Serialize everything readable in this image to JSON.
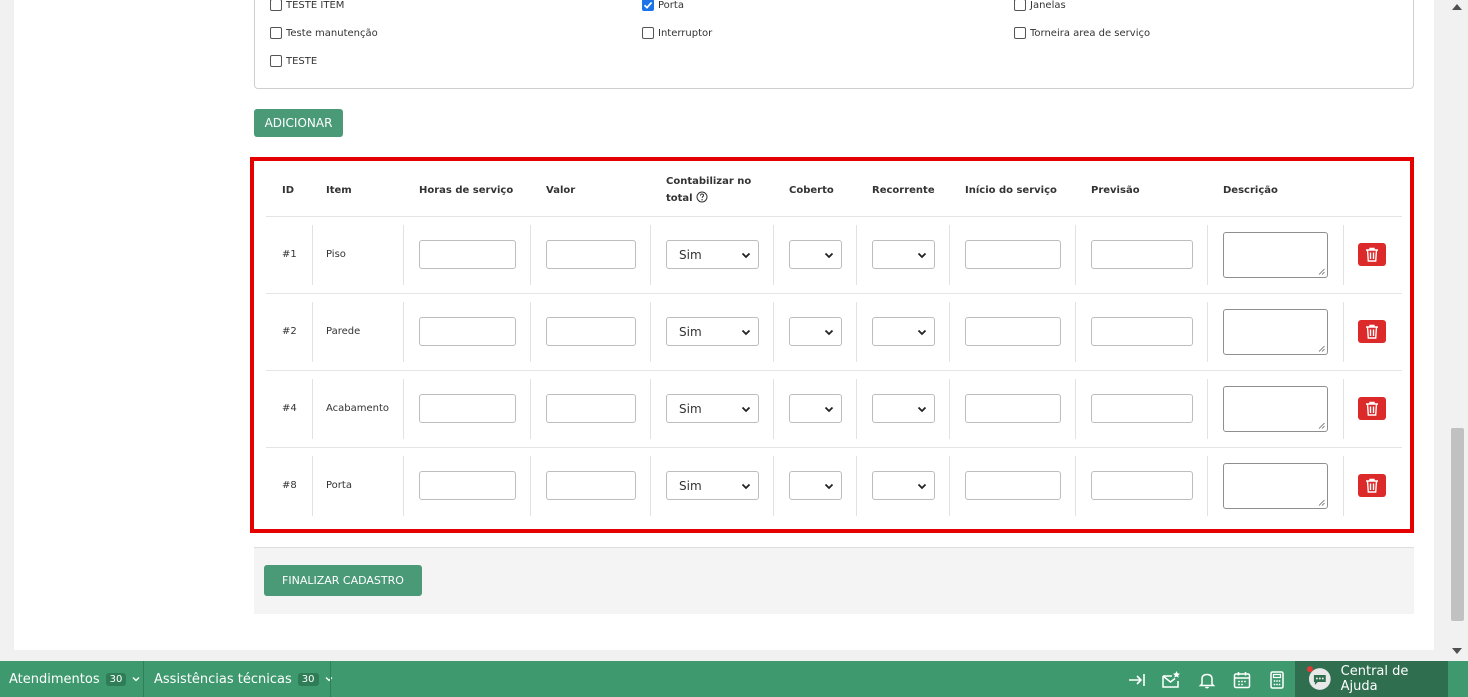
{
  "checkboxes": [
    {
      "label": "TESTE ITEM",
      "checked": false
    },
    {
      "label": "Porta",
      "checked": true
    },
    {
      "label": "Janelas",
      "checked": false
    },
    {
      "label": "Teste manutenção",
      "checked": false
    },
    {
      "label": "Interruptor",
      "checked": false
    },
    {
      "label": "Torneira area de serviço",
      "checked": false
    },
    {
      "label": "TESTE",
      "checked": false
    }
  ],
  "add_button": "ADICIONAR",
  "table": {
    "headers": {
      "id": "ID",
      "item": "Item",
      "hours": "Horas de serviço",
      "value": "Valor",
      "count_line1": "Contabilizar no",
      "count_line2": "total",
      "covered": "Coberto",
      "recurring": "Recorrente",
      "start": "Início do serviço",
      "forecast": "Previsão",
      "description": "Descrição"
    },
    "rows": [
      {
        "id": "#1",
        "item": "Piso",
        "count": "Sim"
      },
      {
        "id": "#2",
        "item": "Parede",
        "count": "Sim"
      },
      {
        "id": "#4",
        "item": "Acabamento",
        "count": "Sim"
      },
      {
        "id": "#8",
        "item": "Porta",
        "count": "Sim"
      }
    ]
  },
  "finish_button": "FINALIZAR CADASTRO",
  "bottom_bar": {
    "atendimentos": {
      "label": "Atendimentos",
      "count": "30"
    },
    "assistencias": {
      "label": "Assistências técnicas",
      "count": "30"
    },
    "help": "Central de Ajuda"
  },
  "colors": {
    "accent": "#4a9a78",
    "bar": "#3e9a6e",
    "delete": "#dc2a2a",
    "highlight": "#e50000"
  }
}
